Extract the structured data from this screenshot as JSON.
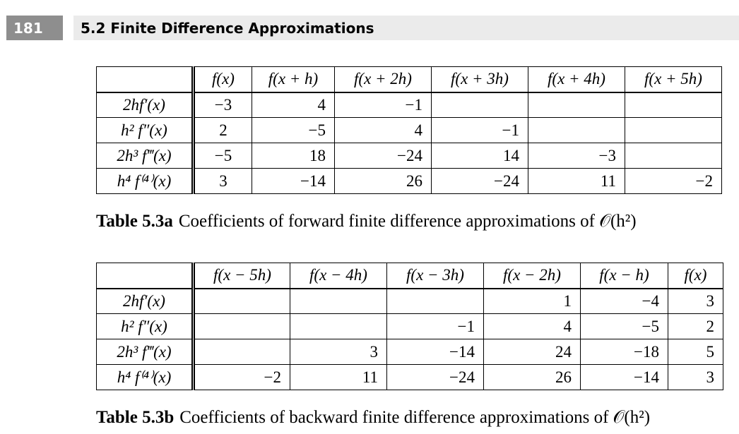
{
  "header": {
    "page_number": "181",
    "section_title": "5.2 Finite Difference Approximations"
  },
  "table_a": {
    "columns": [
      "f(x)",
      "f(x + h)",
      "f(x + 2h)",
      "f(x + 3h)",
      "f(x + 4h)",
      "f(x + 5h)"
    ],
    "rows": [
      {
        "label": "2hf′(x)",
        "cells": [
          "−3",
          "4",
          "−1",
          "",
          "",
          ""
        ]
      },
      {
        "label": "h² f″(x)",
        "cells": [
          "2",
          "−5",
          "4",
          "−1",
          "",
          ""
        ]
      },
      {
        "label": "2h³ f‴(x)",
        "cells": [
          "−5",
          "18",
          "−24",
          "14",
          "−3",
          ""
        ]
      },
      {
        "label": "h⁴ f⁽⁴⁾(x)",
        "cells": [
          "3",
          "−14",
          "26",
          "−24",
          "11",
          "−2"
        ]
      }
    ],
    "caption_label": "Table 5.3a",
    "caption_text": "Coefficients of forward finite difference approximations of 𝒪(h²)"
  },
  "table_b": {
    "columns": [
      "f(x − 5h)",
      "f(x − 4h)",
      "f(x − 3h)",
      "f(x − 2h)",
      "f(x − h)",
      "f(x)"
    ],
    "rows": [
      {
        "label": "2hf′(x)",
        "cells": [
          "",
          "",
          "",
          "1",
          "−4",
          "3"
        ]
      },
      {
        "label": "h² f″(x)",
        "cells": [
          "",
          "",
          "−1",
          "4",
          "−5",
          "2"
        ]
      },
      {
        "label": "2h³ f‴(x)",
        "cells": [
          "",
          "3",
          "−14",
          "24",
          "−18",
          "5"
        ]
      },
      {
        "label": "h⁴ f⁽⁴⁾(x)",
        "cells": [
          "−2",
          "11",
          "−24",
          "26",
          "−14",
          "3"
        ]
      }
    ],
    "caption_label": "Table 5.3b",
    "caption_text": "Coefficients of backward finite difference approximations of 𝒪(h²)"
  }
}
